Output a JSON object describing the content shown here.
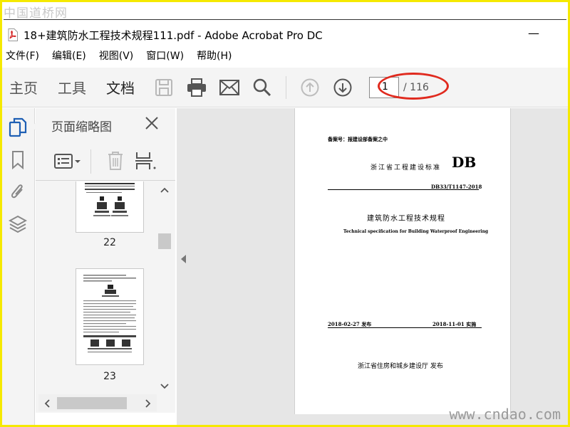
{
  "watermark": {
    "top": "中国道桥网",
    "bottom": "www.cndao.com"
  },
  "window": {
    "title": "18+建筑防水工程技术规程111.pdf - Adobe Acrobat Pro DC",
    "minimize": "—"
  },
  "menu": [
    "文件(F)",
    "编辑(E)",
    "视图(V)",
    "窗口(W)",
    "帮助(H)"
  ],
  "toolbar": {
    "tabs": [
      "主页",
      "工具",
      "文档"
    ],
    "active_tab": "文档",
    "page_current": "1",
    "page_total": "/ 116"
  },
  "thumbnail_panel": {
    "title": "页面缩略图",
    "pages": [
      {
        "label": "22"
      },
      {
        "label": "23"
      }
    ]
  },
  "document": {
    "record_no": "备案号：报建设部备案之中",
    "standard_type": "浙江省工程建设标准",
    "standard_code": "DB",
    "standard_number": "DB33/T1147-2018",
    "title_cn": "建筑防水工程技术规程",
    "title_en": "Technical specification for Building Waterproof Engineering",
    "issue_date": "2018-02-27   发布",
    "effective_date": "2018-11-01 实施",
    "publisher": "浙江省住房和城乡建设厅   发布"
  },
  "colors": {
    "accent": "#1e5fb4",
    "highlight": "#e02a1e",
    "frame": "#f5e900"
  }
}
